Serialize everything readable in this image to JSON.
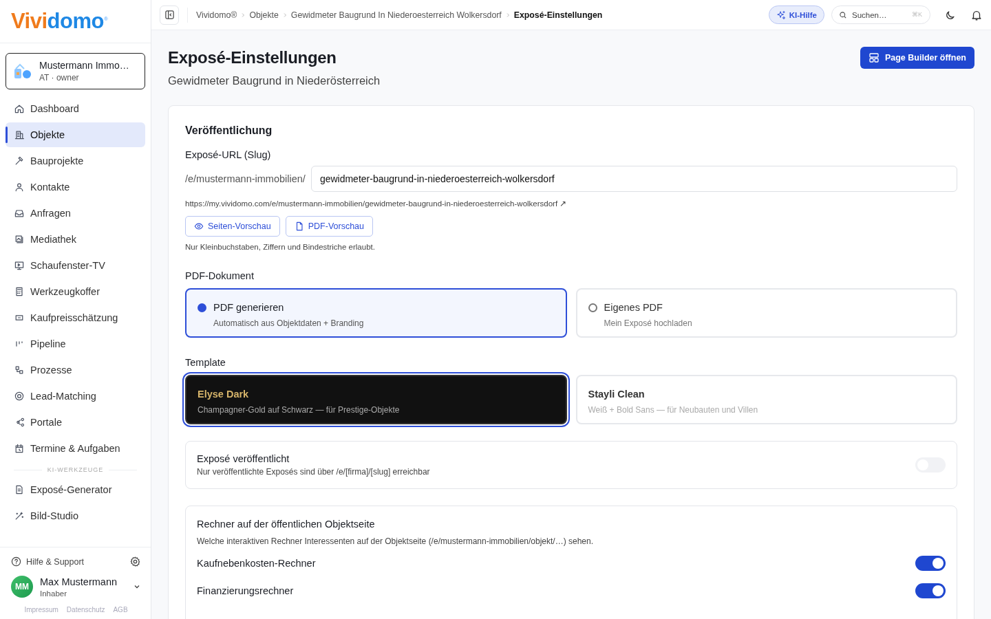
{
  "logo": {
    "first": "Vivi",
    "second": "domo",
    "mark": "®"
  },
  "org": {
    "name": "Mustermann Immo…",
    "meta": "AT · owner"
  },
  "nav": [
    {
      "label": "Dashboard",
      "selected": false
    },
    {
      "label": "Objekte",
      "selected": true
    },
    {
      "label": "Bauprojekte",
      "selected": false
    },
    {
      "label": "Kontakte",
      "selected": false
    },
    {
      "label": "Anfragen",
      "selected": false
    },
    {
      "label": "Mediathek",
      "selected": false
    },
    {
      "label": "Schaufenster-TV",
      "selected": false
    },
    {
      "label": "Werkzeugkoffer",
      "selected": false
    },
    {
      "label": "Kaufpreisschätzung",
      "selected": false
    },
    {
      "label": "Pipeline",
      "selected": false
    },
    {
      "label": "Prozesse",
      "selected": false
    },
    {
      "label": "Lead-Matching",
      "selected": false
    },
    {
      "label": "Portale",
      "selected": false
    },
    {
      "label": "Termine & Aufgaben",
      "selected": false
    }
  ],
  "ai_section": {
    "heading": "KI-WERKZEUGE",
    "items": [
      {
        "label": "Exposé-Generator",
        "selected": false
      },
      {
        "label": "Bild-Studio",
        "selected": false
      }
    ]
  },
  "help": "Hilfe & Support",
  "user": {
    "initials": "MM",
    "name": "Max Mustermann",
    "role": "Inhaber"
  },
  "footer_links": [
    "Impressum",
    "Datenschutz",
    "AGB"
  ],
  "breadcrumbs": [
    "Vividomo®",
    "Objekte",
    "Gewidmeter Baugrund In Niederoesterreich Wolkersdorf",
    "Exposé-Einstellungen"
  ],
  "ai_help": "KI-Hilfe",
  "search": {
    "placeholder": "Suchen…",
    "shortcut": "⌘K"
  },
  "page": {
    "title": "Exposé-Einstellungen",
    "subtitle": "Gewidmeter Baugrund in Niederösterreich",
    "action": "Page Builder öffnen"
  },
  "publication": {
    "heading": "Veröffentlichung",
    "slug_label": "Exposé-URL (Slug)",
    "prefix": "/e/mustermann-immobilien/",
    "slug": "gewidmeter-baugrund-in-niederoesterreich-wolkersdorf",
    "url": "https://my.vividomo.com/e/mustermann-immobilien/gewidmeter-baugrund-in-niederoesterreich-wolkersdorf ↗",
    "buttons": [
      "Seiten-Vorschau",
      "PDF-Vorschau"
    ],
    "hint": "Nur Kleinbuchstaben, Ziffern und Bindestriche erlaubt."
  },
  "pdf": {
    "heading": "PDF-Dokument",
    "options": [
      {
        "title": "PDF generieren",
        "desc": "Automatisch aus Objektdaten + Branding",
        "selected": true
      },
      {
        "title": "Eigenes PDF",
        "desc": "Mein Exposé hochladen",
        "selected": false
      }
    ]
  },
  "template": {
    "heading": "Template",
    "options": [
      {
        "title": "Elyse Dark",
        "desc": "Champagner-Gold auf Schwarz — für Prestige-Objekte",
        "kind": "dark",
        "selected": true
      },
      {
        "title": "Stayli Clean",
        "desc": "Weiß + Bold Sans — für Neubauten und Villen",
        "kind": "light",
        "selected": false
      }
    ]
  },
  "published": {
    "title": "Exposé veröffentlicht",
    "desc": "Nur veröffentlichte Exposés sind über /e/[firma]/[slug] erreichbar",
    "on": false
  },
  "calculators": {
    "heading": "Rechner auf der öffentlichen Objektseite",
    "desc": "Welche interaktiven Rechner Interessenten auf der Objektseite (/e/mustermann-immobilien/objekt/…) sehen.",
    "items": [
      {
        "label": "Kaufnebenkosten-Rechner",
        "on": true
      },
      {
        "label": "Finanzierungsrechner",
        "on": true
      }
    ]
  }
}
